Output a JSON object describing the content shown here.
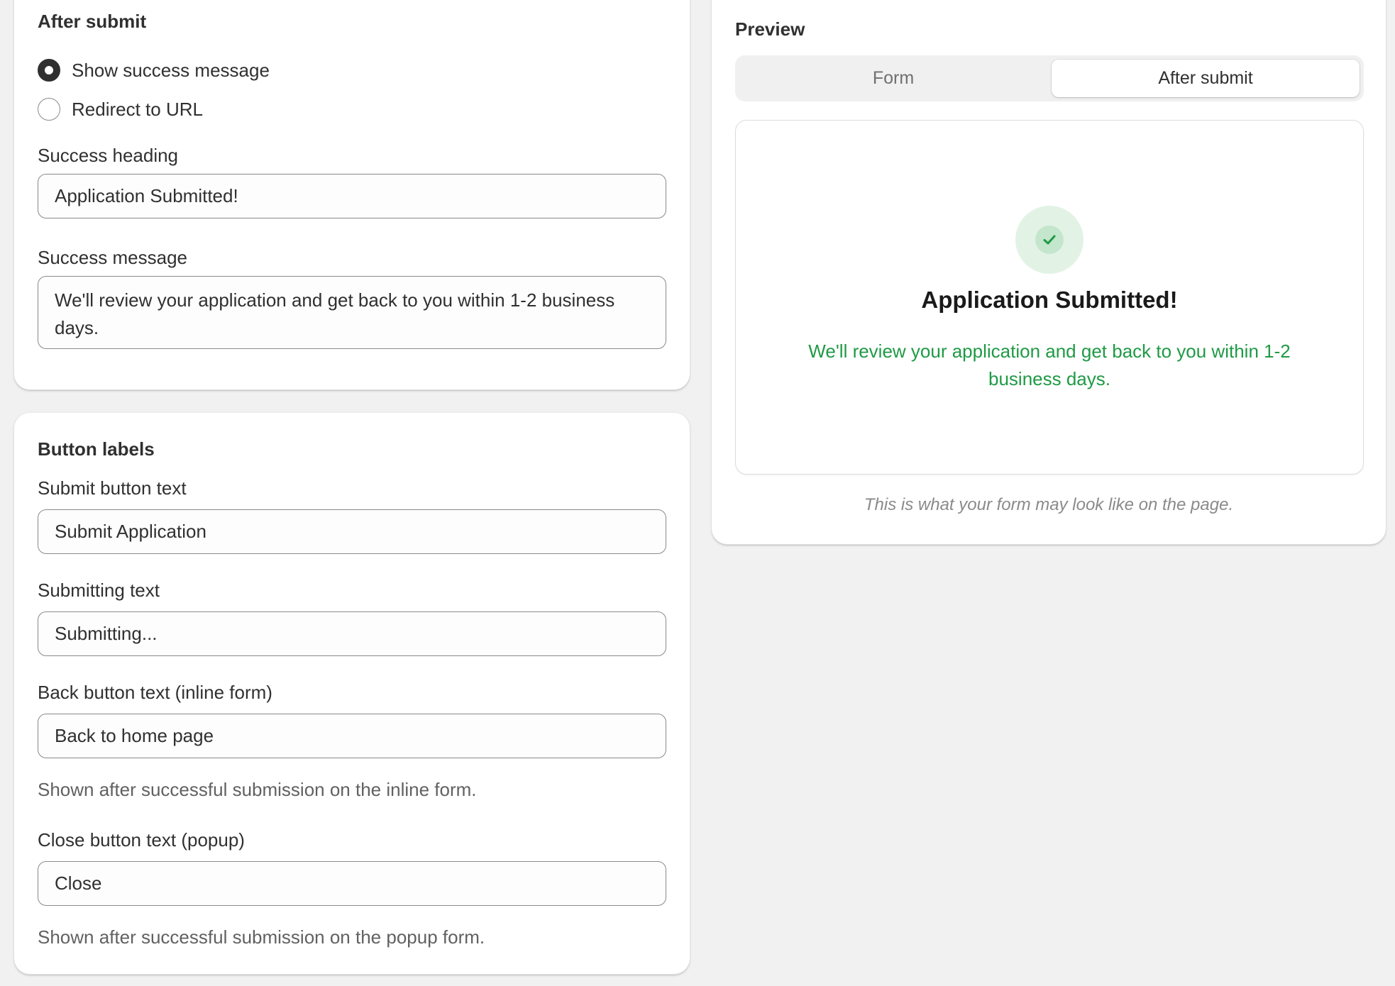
{
  "after_submit": {
    "title": "After submit",
    "options": [
      {
        "label": "Show success message",
        "checked": true
      },
      {
        "label": "Redirect to URL",
        "checked": false
      }
    ],
    "success_heading_label": "Success heading",
    "success_heading_value": "Application Submitted!",
    "success_message_label": "Success message",
    "success_message_value": "We'll review your application and get back to you within 1-2 business days."
  },
  "button_labels": {
    "title": "Button labels",
    "submit_label": "Submit button text",
    "submit_value": "Submit Application",
    "submitting_label": "Submitting text",
    "submitting_value": "Submitting...",
    "back_label": "Back button text (inline form)",
    "back_value": "Back to home page",
    "back_help": "Shown after successful submission on the inline form.",
    "close_label": "Close button text (popup)",
    "close_value": "Close",
    "close_help": "Shown after successful submission on the popup form."
  },
  "preview": {
    "title": "Preview",
    "tabs": [
      {
        "label": "Form",
        "active": false
      },
      {
        "label": "After submit",
        "active": true
      }
    ],
    "icon": "check-circle-icon",
    "heading": "Application Submitted!",
    "message": "We'll review your application and get back to you within 1-2 business days.",
    "caption": "This is what your form may look like on the page."
  },
  "colors": {
    "page_background": "#f1f1f1",
    "card_background": "#ffffff",
    "success_green": "#1f9a45",
    "success_circle": "#e2f3e6"
  }
}
